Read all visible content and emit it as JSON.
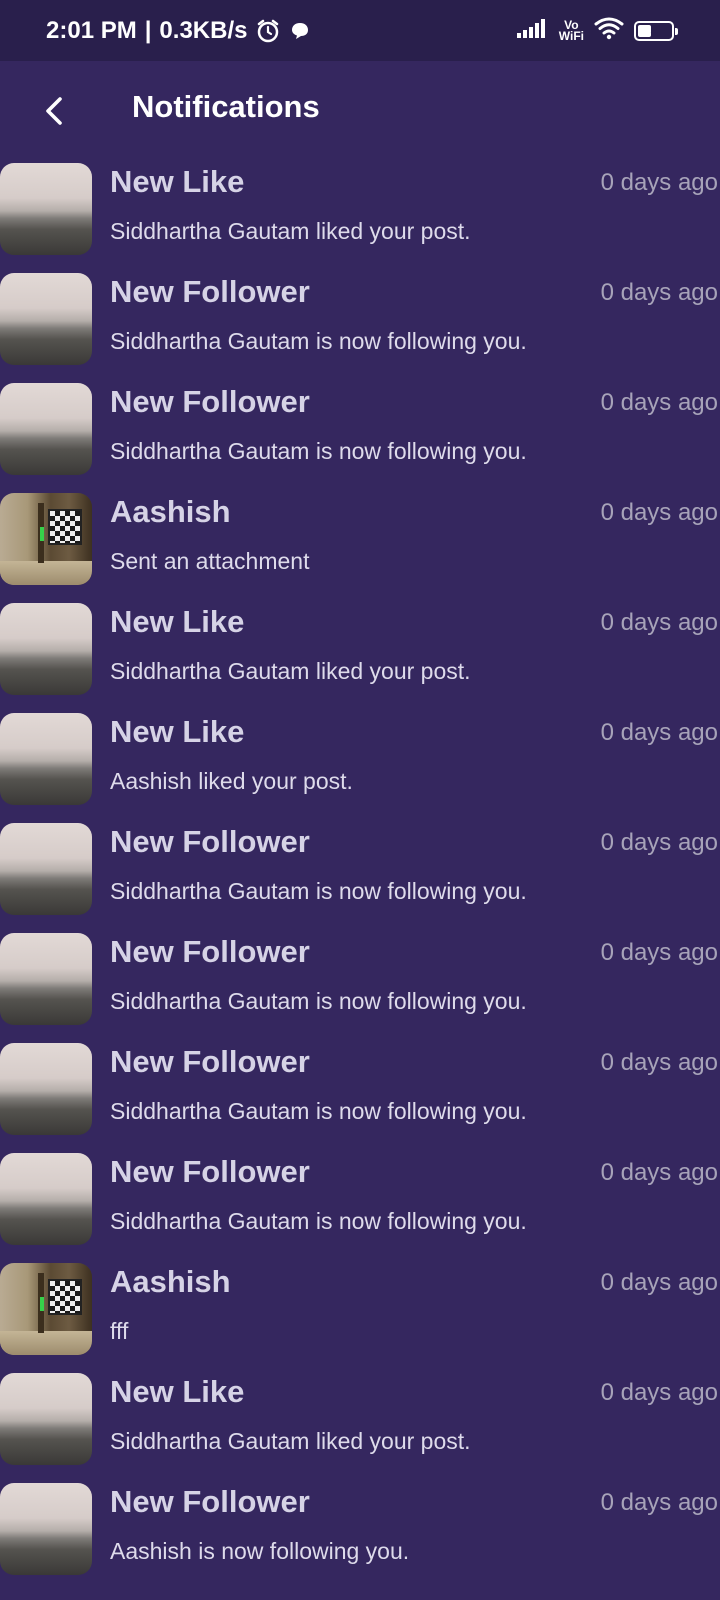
{
  "status_bar": {
    "time": "2:01 PM",
    "separator": "|",
    "net_speed": "0.3KB/s",
    "vowifi_top": "Vo",
    "vowifi_bottom": "WiFi",
    "battery_level": "5"
  },
  "header": {
    "title": "Notifications"
  },
  "colors": {
    "background": "#35275f",
    "status_bar": "#291f4c",
    "title_text": "#d6d3e6",
    "time_text": "#a7a3b9"
  },
  "notifications": [
    {
      "title": "New Like",
      "time": "0 days ago",
      "body": "Siddhartha Gautam liked your post.",
      "avatar": "sea"
    },
    {
      "title": "New Follower",
      "time": "0 days ago",
      "body": "Siddhartha Gautam is now following you.",
      "avatar": "sea"
    },
    {
      "title": "New Follower",
      "time": "0 days ago",
      "body": "Siddhartha Gautam is now following you.",
      "avatar": "sea"
    },
    {
      "title": "Aashish",
      "time": "0 days ago",
      "body": "Sent an attachment",
      "avatar": "room"
    },
    {
      "title": "New Like",
      "time": "0 days ago",
      "body": "Siddhartha Gautam liked your post.",
      "avatar": "sea"
    },
    {
      "title": "New Like",
      "time": "0 days ago",
      "body": "Aashish liked your post.",
      "avatar": "sea"
    },
    {
      "title": "New Follower",
      "time": "0 days ago",
      "body": "Siddhartha Gautam is now following you.",
      "avatar": "sea"
    },
    {
      "title": "New Follower",
      "time": "0 days ago",
      "body": "Siddhartha Gautam is now following you.",
      "avatar": "sea"
    },
    {
      "title": "New Follower",
      "time": "0 days ago",
      "body": "Siddhartha Gautam is now following you.",
      "avatar": "sea"
    },
    {
      "title": "New Follower",
      "time": "0 days ago",
      "body": "Siddhartha Gautam is now following you.",
      "avatar": "sea"
    },
    {
      "title": "Aashish",
      "time": "0 days ago",
      "body": "fff",
      "avatar": "room"
    },
    {
      "title": "New Like",
      "time": "0 days ago",
      "body": "Siddhartha Gautam liked your post.",
      "avatar": "sea"
    },
    {
      "title": "New Follower",
      "time": "0 days ago",
      "body": "Aashish is now following you.",
      "avatar": "sea"
    }
  ]
}
